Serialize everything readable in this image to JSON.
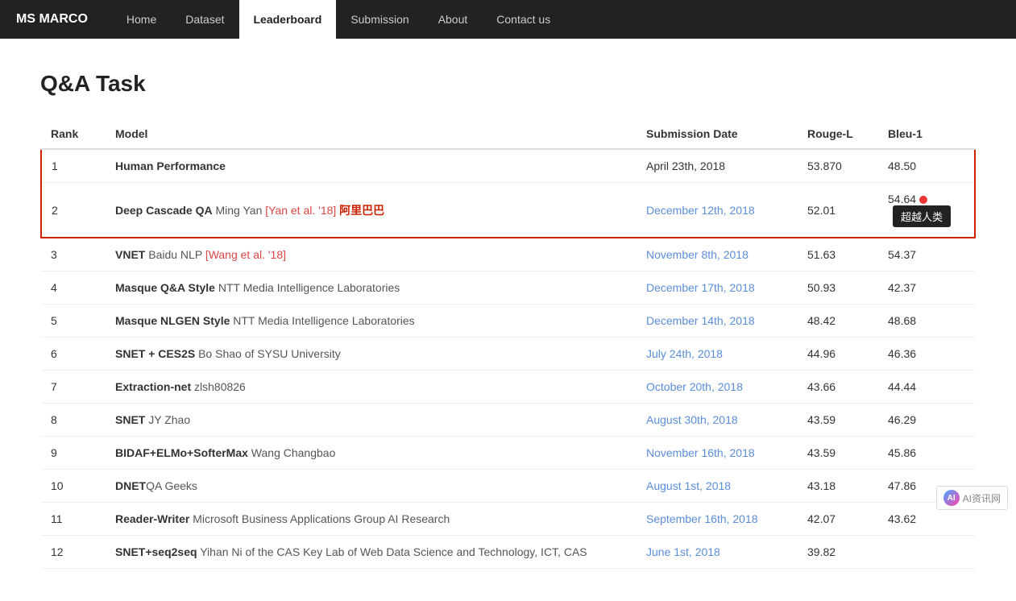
{
  "brand": "MS MARCO",
  "nav": {
    "items": [
      {
        "label": "Home",
        "active": false
      },
      {
        "label": "Dataset",
        "active": false
      },
      {
        "label": "Leaderboard",
        "active": true
      },
      {
        "label": "Submission",
        "active": false
      },
      {
        "label": "About",
        "active": false
      },
      {
        "label": "Contact us",
        "active": false
      }
    ]
  },
  "page": {
    "title": "Q&A Task"
  },
  "table": {
    "headers": [
      "Rank",
      "Model",
      "Submission Date",
      "Rouge-L",
      "Bleu-1"
    ],
    "rows": [
      {
        "rank": "1",
        "model_bold": "Human Performance",
        "model_extra": "",
        "model_link_text": "",
        "model_link_href": "",
        "model_chinese": "",
        "date_text": "April 23th, 2018",
        "date_link": false,
        "rouge": "53.870",
        "bleu": "48.50",
        "highlight": true,
        "red_dot": false,
        "tooltip": ""
      },
      {
        "rank": "2",
        "model_bold": "Deep Cascade QA",
        "model_extra": " Ming Yan ",
        "model_link_text": "[Yan et al. '18]",
        "model_chinese": "  阿里巴巴",
        "date_text": "December 12th, 2018",
        "date_link": true,
        "rouge": "52.01",
        "bleu": "54.64",
        "highlight": true,
        "red_dot": true,
        "tooltip": "超越人类"
      },
      {
        "rank": "3",
        "model_bold": "VNET",
        "model_extra": " Baidu NLP ",
        "model_link_text": "[Wang et al. '18]",
        "model_chinese": "",
        "date_text": "November 8th, 2018",
        "date_link": true,
        "rouge": "51.63",
        "bleu": "54.37",
        "highlight": false,
        "red_dot": false,
        "tooltip": ""
      },
      {
        "rank": "4",
        "model_bold": "Masque Q&A Style",
        "model_extra": " NTT Media Intelligence Laboratories",
        "model_link_text": "",
        "model_chinese": "",
        "date_text": "December 17th, 2018",
        "date_link": true,
        "rouge": "50.93",
        "bleu": "42.37",
        "highlight": false,
        "red_dot": false,
        "tooltip": ""
      },
      {
        "rank": "5",
        "model_bold": "Masque NLGEN Style",
        "model_extra": " NTT Media Intelligence Laboratories",
        "model_link_text": "",
        "model_chinese": "",
        "date_text": "December 14th, 2018",
        "date_link": true,
        "rouge": "48.42",
        "bleu": "48.68",
        "highlight": false,
        "red_dot": false,
        "tooltip": ""
      },
      {
        "rank": "6",
        "model_bold": "SNET + CES2S",
        "model_extra": " Bo Shao of SYSU University",
        "model_link_text": "",
        "model_chinese": "",
        "date_text": "July 24th, 2018",
        "date_link": true,
        "rouge": "44.96",
        "bleu": "46.36",
        "highlight": false,
        "red_dot": false,
        "tooltip": ""
      },
      {
        "rank": "7",
        "model_bold": "Extraction-net",
        "model_extra": " zlsh80826",
        "model_link_text": "",
        "model_chinese": "",
        "date_text": "October 20th, 2018",
        "date_link": true,
        "rouge": "43.66",
        "bleu": "44.44",
        "highlight": false,
        "red_dot": false,
        "tooltip": ""
      },
      {
        "rank": "8",
        "model_bold": "SNET",
        "model_extra": " JY Zhao",
        "model_link_text": "",
        "model_chinese": "",
        "date_text": "August 30th, 2018",
        "date_link": true,
        "rouge": "43.59",
        "bleu": "46.29",
        "highlight": false,
        "red_dot": false,
        "tooltip": ""
      },
      {
        "rank": "9",
        "model_bold": "BIDAF+ELMo+SofterMax",
        "model_extra": " Wang Changbao",
        "model_link_text": "",
        "model_chinese": "",
        "date_text": "November 16th, 2018",
        "date_link": true,
        "rouge": "43.59",
        "bleu": "45.86",
        "highlight": false,
        "red_dot": false,
        "tooltip": ""
      },
      {
        "rank": "10",
        "model_bold": "DNET",
        "model_extra": "QA Geeks",
        "model_link_text": "",
        "model_chinese": "",
        "date_text": "August 1st, 2018",
        "date_link": true,
        "rouge": "43.18",
        "bleu": "47.86",
        "highlight": false,
        "red_dot": false,
        "tooltip": ""
      },
      {
        "rank": "11",
        "model_bold": "Reader-Writer",
        "model_extra": " Microsoft Business Applications Group AI Research",
        "model_link_text": "",
        "model_chinese": "",
        "date_text": "September 16th, 2018",
        "date_link": true,
        "rouge": "42.07",
        "bleu": "43.62",
        "highlight": false,
        "red_dot": false,
        "tooltip": ""
      },
      {
        "rank": "12",
        "model_bold": "SNET+seq2seq",
        "model_extra": " Yihan Ni of the CAS Key Lab of Web Data Science and Technology, ICT, CAS",
        "model_link_text": "",
        "model_chinese": "",
        "date_text": "June 1st, 2018",
        "date_link": true,
        "rouge": "39.82",
        "bleu": "",
        "highlight": false,
        "red_dot": false,
        "tooltip": ""
      }
    ]
  },
  "watermark": {
    "text": "AI资讯网"
  }
}
